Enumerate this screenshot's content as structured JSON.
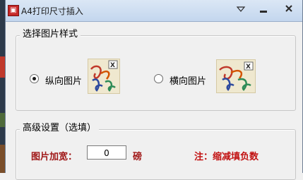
{
  "window": {
    "title": "A4打印尺寸插入"
  },
  "style_group": {
    "title": "选择图片样式",
    "options": [
      {
        "label": "纵向图片",
        "selected": true
      },
      {
        "label": "横向图片",
        "selected": false
      }
    ]
  },
  "advanced_group": {
    "title": "高级设置（选填）",
    "width_label": "图片加宽：",
    "width_value": "0",
    "unit": "磅",
    "note": "注：缩减填负数"
  },
  "colors": {
    "label_red": "#a01818",
    "note_red": "#c21212"
  }
}
